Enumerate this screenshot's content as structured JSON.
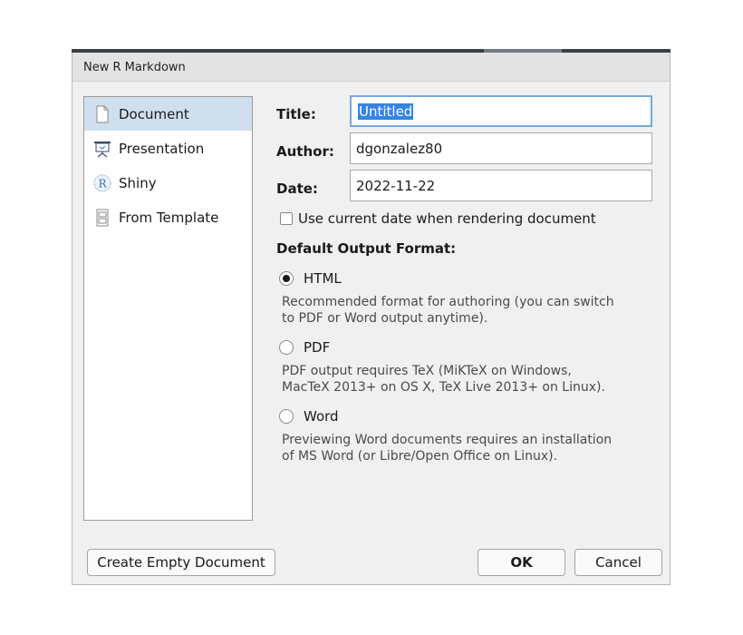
{
  "dialog": {
    "title": "New R Markdown"
  },
  "sidebar": {
    "items": [
      {
        "label": "Document",
        "icon": "document-icon",
        "selected": true
      },
      {
        "label": "Presentation",
        "icon": "presentation-icon",
        "selected": false
      },
      {
        "label": "Shiny",
        "icon": "shiny-r-icon",
        "selected": false
      },
      {
        "label": "From Template",
        "icon": "template-icon",
        "selected": false
      }
    ]
  },
  "form": {
    "title_label": "Title:",
    "title_value": "Untitled",
    "author_label": "Author:",
    "author_value": "dgonzalez80",
    "date_label": "Date:",
    "date_value": "2022-11-22",
    "use_current_date_label": "Use current date when rendering document",
    "use_current_date_checked": false
  },
  "output": {
    "heading": "Default Output Format:",
    "options": [
      {
        "label": "HTML",
        "checked": true,
        "desc_line1": "Recommended format for authoring (you can switch",
        "desc_line2": "to PDF or Word output anytime)."
      },
      {
        "label": "PDF",
        "checked": false,
        "desc_line1": "PDF output requires TeX (MiKTeX on Windows,",
        "desc_line2": "MacTeX 2013+ on OS X, TeX Live 2013+ on Linux)."
      },
      {
        "label": "Word",
        "checked": false,
        "desc_line1": "Previewing Word documents requires an installation",
        "desc_line2": "of MS Word (or Libre/Open Office on Linux)."
      }
    ]
  },
  "buttons": {
    "create_empty": "Create Empty Document",
    "ok": "OK",
    "cancel": "Cancel"
  },
  "colors": {
    "selection_highlight": "#3584e4",
    "sidebar_selected": "#cfdfee",
    "focus_border": "#79a8d6"
  }
}
